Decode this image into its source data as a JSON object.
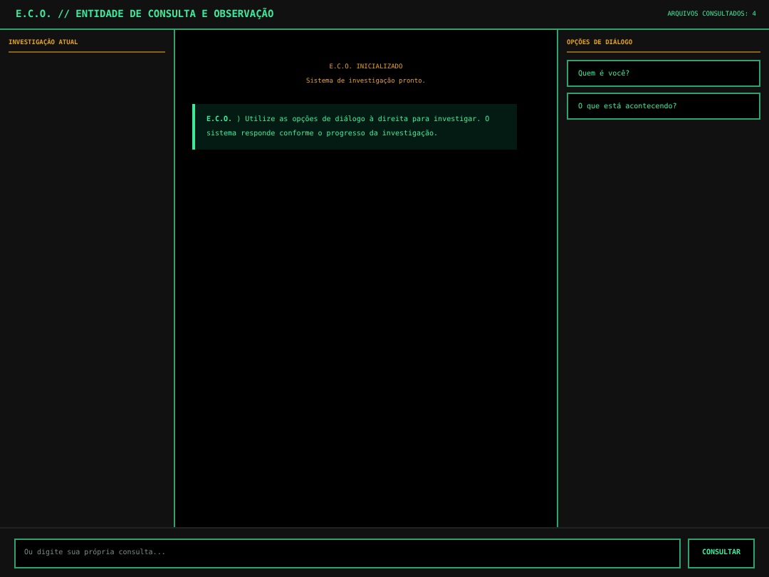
{
  "header": {
    "title": "E.C.O. // ENTIDADE DE CONSULTA E OBSERVAÇÃO",
    "files_consulted": "ARQUIVOS CONSULTADOS: 4"
  },
  "left_panel": {
    "title": "INVESTIGAÇÃO ATUAL"
  },
  "log": {
    "status_title": "E.C.O. INICIALIZADO",
    "status_text": "Sistema de investigação pronto.",
    "messages": [
      {
        "speaker": "E.C.O.",
        "text": " ⟩ Utilize as opções de diálogo à direita para investigar. O sistema responde conforme o progresso da investigação."
      }
    ]
  },
  "right_panel": {
    "title": "OPÇÕES DE DIÁLOGO",
    "options": [
      "Quem é você?",
      "O que está acontecendo?"
    ]
  },
  "input": {
    "placeholder": "Ou digite sua própria consulta...",
    "button": "CONSULTAR"
  }
}
